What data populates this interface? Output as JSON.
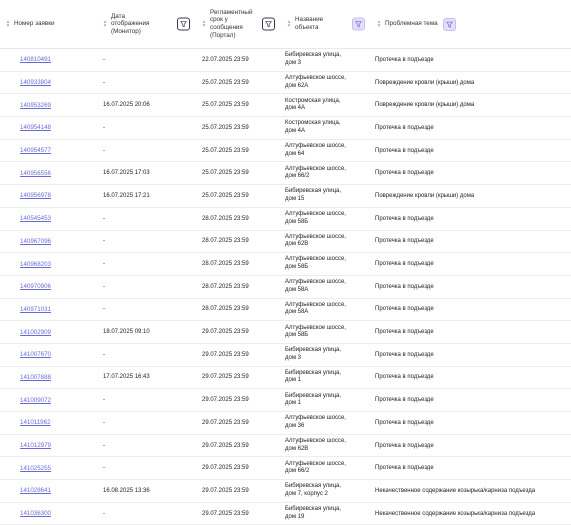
{
  "columns": {
    "number": "Номер заявки",
    "display_date": [
      "Дата",
      "отображения",
      "(Монитор)"
    ],
    "deadline": [
      "Регламентный",
      "срок у",
      "сообщения",
      "(Портал)"
    ],
    "object": [
      "Название",
      "объекта"
    ],
    "topic": "Проблемная тема"
  },
  "rows": [
    {
      "number": "140810491",
      "display_date": "-",
      "deadline": "22.07.2025 23:59",
      "object": [
        "Бибиревская улица,",
        "дом 3"
      ],
      "topic": "Протечка в подъезде"
    },
    {
      "number": "140933804",
      "display_date": "-",
      "deadline": "25.07.2025 23:59",
      "object": [
        "Алтуфьевское шоссе,",
        "дом 62А"
      ],
      "topic": "Повреждение кровли (крыши) дома"
    },
    {
      "number": "140953269",
      "display_date": "16.07.2025 20:06",
      "deadline": "25.07.2025 23:59",
      "object": [
        "Костромская улица,",
        "дом 4А"
      ],
      "topic": "Повреждение кровли (крыши) дома"
    },
    {
      "number": "140954148",
      "display_date": "-",
      "deadline": "25.07.2025 23:59",
      "object": [
        "Костромская улица,",
        "дом 4А"
      ],
      "topic": "Протечка в подъезде"
    },
    {
      "number": "140954577",
      "display_date": "-",
      "deadline": "25.07.2025 23:59",
      "object": [
        "Алтуфьевское шоссе,",
        "дом 64"
      ],
      "topic": "Протечка в подъезде"
    },
    {
      "number": "140956556",
      "display_date": "16.07.2025 17:03",
      "deadline": "25.07.2025 23:59",
      "object": [
        "Алтуфьевское шоссе,",
        "дом 66/2"
      ],
      "topic": "Протечка в подъезде"
    },
    {
      "number": "140956978",
      "display_date": "16.07.2025 17:21",
      "deadline": "25.07.2025 23:59",
      "object": [
        "Бибиревская улица,",
        "дом 15"
      ],
      "topic": "Повреждение кровли (крыши) дома"
    },
    {
      "number": "140545453",
      "display_date": "-",
      "deadline": "28.07.2025 23:59",
      "object": [
        "Алтуфьевское шоссе,",
        "дом 58Б"
      ],
      "topic": "Протечка в подъезде"
    },
    {
      "number": "140967096",
      "display_date": "-",
      "deadline": "28.07.2025 23:59",
      "object": [
        "Алтуфьевское шоссе,",
        "дом 62В"
      ],
      "topic": "Протечка в подъезде"
    },
    {
      "number": "140968203",
      "display_date": "-",
      "deadline": "28.07.2025 23:59",
      "object": [
        "Алтуфьевское шоссе,",
        "дом 58Б"
      ],
      "topic": "Протечка в подъезде"
    },
    {
      "number": "140970906",
      "display_date": "-",
      "deadline": "28.07.2025 23:59",
      "object": [
        "Алтуфьевское шоссе,",
        "дом 58А"
      ],
      "topic": "Протечка в подъезде"
    },
    {
      "number": "140971031",
      "display_date": "-",
      "deadline": "28.07.2025 23:59",
      "object": [
        "Алтуфьевское шоссе,",
        "дом 58А"
      ],
      "topic": "Протечка в подъезде"
    },
    {
      "number": "141002909",
      "display_date": "18.07.2025 09:10",
      "deadline": "29.07.2025 23:59",
      "object": [
        "Алтуфьевское шоссе,",
        "дом 58Б"
      ],
      "topic": "Протечка в подъезде"
    },
    {
      "number": "141007670",
      "display_date": "-",
      "deadline": "29.07.2025 23:59",
      "object": [
        "Бибиревская улица,",
        "дом 3"
      ],
      "topic": "Протечка в подъезде"
    },
    {
      "number": "141007888",
      "display_date": "17.07.2025 16:43",
      "deadline": "29.07.2025 23:59",
      "object": [
        "Бибиревская улица,",
        "дом 1"
      ],
      "topic": "Протечка в подъезде"
    },
    {
      "number": "141009072",
      "display_date": "-",
      "deadline": "29.07.2025 23:59",
      "object": [
        "Бибиревская улица,",
        "дом 1"
      ],
      "topic": "Протечка в подъезде"
    },
    {
      "number": "141011962",
      "display_date": "-",
      "deadline": "29.07.2025 23:59",
      "object": [
        "Алтуфьевское шоссе,",
        "дом 36"
      ],
      "topic": "Протечка в подъезде"
    },
    {
      "number": "141012979",
      "display_date": "-",
      "deadline": "29.07.2025 23:59",
      "object": [
        "Алтуфьевское шоссе,",
        "дом 62В"
      ],
      "topic": "Протечка в подъезде"
    },
    {
      "number": "141025255",
      "display_date": "-",
      "deadline": "29.07.2025 23:59",
      "object": [
        "Алтуфьевское шоссе,",
        "дом 66/2"
      ],
      "topic": "Протечка в подъезде"
    },
    {
      "number": "141028641",
      "display_date": "16.08.2025 13:36",
      "deadline": "29.07.2025 23:59",
      "object": [
        "Бибиревская улица,",
        "дом 7, корпус 2"
      ],
      "topic": "Некачественное содержание козырька/карниза подъезда"
    },
    {
      "number": "141036300",
      "display_date": "-",
      "deadline": "29.07.2025 23:59",
      "object": [
        "Бибиревская улица,",
        "дом 19"
      ],
      "topic": "Некачественное содержание козырька/карниза подъезда"
    }
  ]
}
